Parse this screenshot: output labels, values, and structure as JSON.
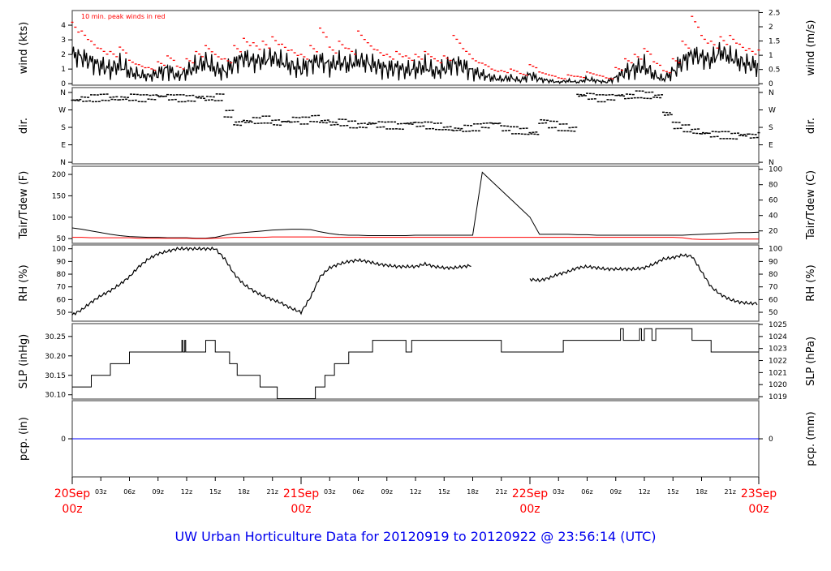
{
  "chart_data": {
    "type": "line",
    "title": "UW Urban Horticulture Data for 20120919  to  20120922 @ 23:56:14  (UTC)",
    "x_hours_range": [
      0,
      72
    ],
    "x_ticks": [
      {
        "h": 0,
        "label": "20Sep",
        "label2": "00z",
        "day": true
      },
      {
        "h": 3,
        "label": "03z"
      },
      {
        "h": 6,
        "label": "06z"
      },
      {
        "h": 9,
        "label": "09z"
      },
      {
        "h": 12,
        "label": "12z"
      },
      {
        "h": 15,
        "label": "15z"
      },
      {
        "h": 18,
        "label": "18z"
      },
      {
        "h": 21,
        "label": "21z"
      },
      {
        "h": 24,
        "label": "21Sep",
        "label2": "00z",
        "day": true
      },
      {
        "h": 27,
        "label": "03z"
      },
      {
        "h": 30,
        "label": "06z"
      },
      {
        "h": 33,
        "label": "09z"
      },
      {
        "h": 36,
        "label": "12z"
      },
      {
        "h": 39,
        "label": "15z"
      },
      {
        "h": 42,
        "label": "18z"
      },
      {
        "h": 45,
        "label": "21z"
      },
      {
        "h": 48,
        "label": "22Sep",
        "label2": "00z",
        "day": true
      },
      {
        "h": 51,
        "label": "03z"
      },
      {
        "h": 54,
        "label": "06z"
      },
      {
        "h": 57,
        "label": "09z"
      },
      {
        "h": 60,
        "label": "12z"
      },
      {
        "h": 63,
        "label": "15z"
      },
      {
        "h": 66,
        "label": "18z"
      },
      {
        "h": 69,
        "label": "21z"
      },
      {
        "h": 72,
        "label": "23Sep",
        "label2": "00z",
        "day": true
      }
    ],
    "panels": [
      {
        "id": "wind",
        "ylabel": "wind (kts)",
        "ylabel_right": "wind (m/s)",
        "ylim": [
          -0.1,
          5
        ],
        "ylim_right": [
          -0.05,
          2.57
        ],
        "ticks": [
          0,
          1,
          2,
          3,
          4
        ],
        "ticks_right": [
          0,
          0.5,
          1,
          1.5,
          2,
          2.5
        ],
        "annotation": "10 min. peak winds in red"
      },
      {
        "id": "dir",
        "ylabel": "dir.",
        "ylabel_right": "dir.",
        "ylim": [
          -8,
          385
        ],
        "ylim_right": [
          -8,
          385
        ],
        "ticks": [
          0,
          90,
          180,
          270,
          360
        ],
        "tick_labels": [
          "N",
          "E",
          "S",
          "W",
          "N"
        ],
        "ticks_right": [
          0,
          90,
          180,
          270,
          360
        ],
        "tick_labels_right": [
          "N",
          "E",
          "S",
          "W",
          "N"
        ]
      },
      {
        "id": "temp",
        "ylabel": "Tair/Tdew (F)",
        "ylabel_right": "Tair/Tdew (C)",
        "ylim": [
          39,
          219
        ],
        "ylim_right": [
          3.9,
          103.9
        ],
        "ticks": [
          50,
          100,
          150,
          200
        ],
        "ticks_right": [
          20,
          40,
          60,
          80,
          100
        ]
      },
      {
        "id": "rh",
        "ylabel": "RH (%)",
        "ylabel_right": "RH (%)",
        "ylim": [
          43,
          103
        ],
        "ylim_right": [
          43,
          103
        ],
        "ticks": [
          50,
          60,
          70,
          80,
          90,
          100
        ],
        "ticks_right": [
          50,
          60,
          70,
          80,
          90,
          100
        ]
      },
      {
        "id": "slp",
        "ylabel": "SLP (inHg)",
        "ylabel_right": "SLP (hPa)",
        "ylim": [
          30.089,
          30.283
        ],
        "ylim_right": [
          1018.8,
          1025.07
        ],
        "ticks": [
          30.1,
          30.15,
          30.2,
          30.25
        ],
        "tick_labels": [
          "30.10",
          "30.15",
          "30.20",
          "30.25"
        ],
        "ticks_right": [
          1019,
          1020,
          1021,
          1022,
          1023,
          1024,
          1025
        ]
      },
      {
        "id": "pcp",
        "ylabel": "pcp. (in)",
        "ylabel_right": "pcp. (mm)",
        "ylim": [
          -1,
          1
        ],
        "ylim_right": [
          -25.4,
          25.4
        ],
        "ticks": [
          0
        ],
        "ticks_right": [
          0
        ]
      }
    ],
    "series": {
      "wind_mean_kts": [
        2,
        1.8,
        1.5,
        1.2,
        1,
        1.3,
        0.8,
        0.6,
        0.5,
        0.7,
        1,
        0.5,
        0.8,
        1.2,
        1.5,
        1,
        0.8,
        1.4,
        1.8,
        1.5,
        1.6,
        1.8,
        1.5,
        1.2,
        1,
        1.4,
        1.6,
        1.2,
        1.5,
        1.3,
        1.6,
        1.4,
        1.2,
        1,
        1.1,
        0.9,
        1,
        1.2,
        0.8,
        1,
        1.4,
        1.2,
        0.8,
        0.6,
        0.4,
        0.3,
        0.4,
        0.2,
        0.6,
        0.3,
        0.2,
        0.1,
        0.2,
        0.1,
        0.3,
        0.2,
        0.1,
        0.4,
        0.8,
        1,
        1.2,
        0.6,
        0.3,
        0.8,
        1.5,
        2,
        1.8,
        1.6,
        2.2,
        1.8,
        1.5,
        1.3,
        1.2
      ],
      "wind_peak_kts": [
        4.2,
        3.6,
        2.9,
        2.4,
        2.2,
        2.5,
        1.6,
        1.3,
        1.1,
        1.5,
        1.9,
        1.2,
        1.7,
        2.2,
        2.6,
        2,
        1.7,
        2.6,
        3.1,
        2.8,
        2.9,
        3.2,
        2.7,
        2.3,
        2,
        2.6,
        3.8,
        2.5,
        2.9,
        2.4,
        3.6,
        2.8,
        2.3,
        2,
        2.2,
        1.9,
        2,
        2.2,
        1.7,
        1.9,
        3.3,
        2.4,
        1.7,
        1.4,
        1,
        0.9,
        1,
        0.7,
        1.3,
        0.8,
        0.6,
        0.4,
        0.6,
        0.5,
        0.8,
        0.6,
        0.4,
        1.1,
        1.7,
        2,
        2.4,
        1.5,
        0.9,
        1.7,
        2.9,
        4.6,
        3.3,
        2.9,
        3.2,
        3.3,
        2.7,
        2.4,
        2.3
      ],
      "dir_deg": [
        320,
        325,
        330,
        335,
        330,
        330,
        335,
        330,
        335,
        340,
        335,
        330,
        330,
        335,
        330,
        335,
        250,
        200,
        210,
        215,
        220,
        205,
        210,
        220,
        215,
        225,
        210,
        200,
        205,
        195,
        190,
        200,
        195,
        190,
        185,
        200,
        195,
        190,
        185,
        175,
        170,
        175,
        180,
        190,
        200,
        175,
        165,
        160,
        150,
        210,
        195,
        180,
        170,
        345,
        340,
        330,
        335,
        345,
        340,
        350,
        345,
        340,
        250,
        190,
        175,
        160,
        150,
        145,
        140,
        135,
        140,
        135,
        135
      ],
      "tair_F": [
        75,
        72,
        68,
        64,
        60,
        57,
        55,
        54,
        53,
        53,
        52,
        52,
        52,
        51,
        51,
        53,
        58,
        62,
        64,
        66,
        68,
        70,
        71,
        72,
        72,
        71,
        66,
        62,
        59,
        58,
        58,
        57,
        57,
        57,
        57,
        57,
        58,
        58,
        58,
        58,
        58,
        58,
        58,
        205,
        184,
        163,
        142,
        121,
        100,
        60,
        60,
        60,
        60,
        59,
        59,
        58,
        58,
        58,
        58,
        58,
        58,
        58,
        58,
        58,
        58,
        59,
        60,
        61,
        62,
        63,
        64,
        64,
        65
      ],
      "tdew_F": [
        53,
        53,
        52,
        52,
        52,
        52,
        52,
        51,
        51,
        51,
        51,
        51,
        51,
        50,
        50,
        51,
        52,
        53,
        53,
        53,
        53,
        54,
        54,
        54,
        54,
        54,
        54,
        53,
        53,
        53,
        53,
        53,
        53,
        53,
        53,
        53,
        53,
        53,
        53,
        53,
        53,
        53,
        53,
        53,
        53,
        53,
        53,
        53,
        53,
        53,
        53,
        53,
        53,
        53,
        53,
        53,
        53,
        53,
        53,
        53,
        53,
        53,
        53,
        53,
        52,
        49,
        48,
        48,
        48,
        49,
        49,
        49,
        49
      ],
      "rh_pct": [
        48,
        52,
        58,
        63,
        67,
        72,
        78,
        86,
        92,
        96,
        98,
        100,
        100,
        100,
        100,
        100,
        92,
        80,
        72,
        67,
        63,
        60,
        57,
        53,
        50,
        62,
        78,
        85,
        88,
        90,
        91,
        90,
        88,
        87,
        86,
        86,
        86,
        88,
        86,
        85,
        85,
        86,
        87,
        null,
        null,
        null,
        null,
        null,
        76,
        75,
        77,
        80,
        82,
        85,
        86,
        85,
        84,
        84,
        84,
        84,
        85,
        88,
        92,
        93,
        95,
        94,
        82,
        70,
        64,
        60,
        58,
        57,
        57
      ],
      "slp_steps_inHg": [
        [
          0,
          30.12
        ],
        [
          2,
          30.15
        ],
        [
          4,
          30.18
        ],
        [
          6,
          30.21
        ],
        [
          11.5,
          30.24
        ],
        [
          11.6,
          30.21
        ],
        [
          11.8,
          30.24
        ],
        [
          11.9,
          30.21
        ],
        [
          14,
          30.24
        ],
        [
          15,
          30.21
        ],
        [
          16.5,
          30.18
        ],
        [
          17.3,
          30.15
        ],
        [
          19.7,
          30.12
        ],
        [
          21.5,
          30.09
        ],
        [
          25.5,
          30.12
        ],
        [
          26.5,
          30.15
        ],
        [
          27.5,
          30.18
        ],
        [
          29,
          30.21
        ],
        [
          31.5,
          30.24
        ],
        [
          35,
          30.21
        ],
        [
          35.6,
          30.24
        ],
        [
          45,
          30.21
        ],
        [
          51.5,
          30.24
        ],
        [
          57.5,
          30.27
        ],
        [
          57.8,
          30.24
        ],
        [
          59.5,
          30.27
        ],
        [
          59.7,
          30.24
        ],
        [
          60,
          30.27
        ],
        [
          60.8,
          30.24
        ],
        [
          61.2,
          30.27
        ],
        [
          65,
          30.24
        ],
        [
          67,
          30.21
        ],
        [
          72,
          30.21
        ]
      ],
      "pcp_in": [
        [
          0,
          0
        ],
        [
          72,
          0
        ]
      ]
    },
    "colors": {
      "peak": "#ff0000",
      "tdew": "#ff0000",
      "pcp": "#0000ff",
      "day_label": "#ff0000",
      "title": "#0000ee"
    }
  }
}
